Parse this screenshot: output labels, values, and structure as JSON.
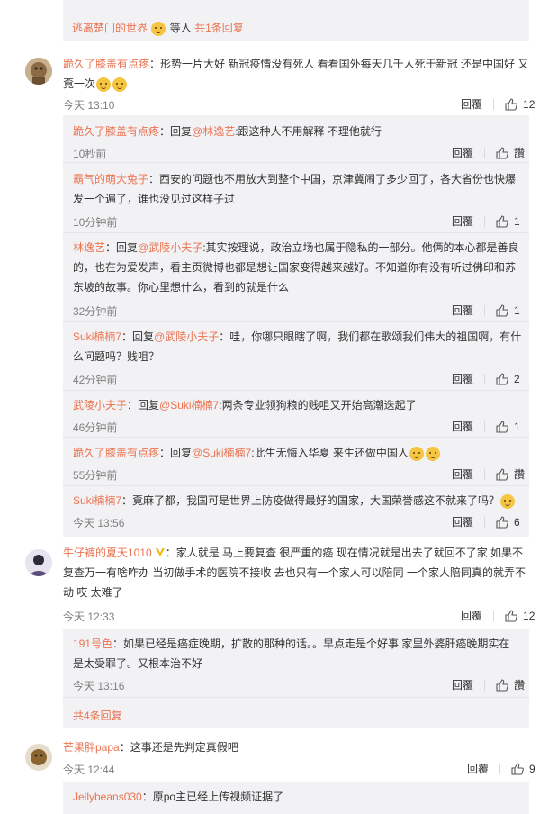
{
  "top_more": {
    "user": "逃离楚门的世界",
    "suffix": "等人",
    "link": "共1条回复"
  },
  "actions": {
    "reply": "回覆",
    "like_text": "讚"
  },
  "comments": [
    {
      "user": "跪久了膝盖有点疼",
      "text_line1": "：形势一片大好 新冠疫情没有死人 看看国外每天几千人死于新冠 还是中国好 又",
      "text_line2": "覔一次",
      "time": "今天 13:10",
      "likes": "12",
      "replies": [
        {
          "user": "跪久了膝盖有点疼",
          "pre": "：回复",
          "mention": "@林逸艺",
          "text": ":跟这种人不用解释 不理他就行",
          "time": "10秒前",
          "likes": "讚"
        },
        {
          "user": "霸气的萌大兔子",
          "text_line1": "：西安的问题也不用放大到整个中国，京津冀闹了多少回了，各大省份也快爆",
          "text_line2": "发一个遍了，谁也没见过这样子过",
          "time": "10分钟前",
          "likes": "1"
        },
        {
          "user": "林逸艺",
          "pre": "：回复",
          "mention": "@武陵小夫子",
          "text_line1": ":其实按理说，政治立场也属于隐私的一部分。他俩的本心都是善良",
          "text_line2": "的，也在为爱发声，看主页微博也都是想让国家变得越来越好。不知道你有没有听过佛印和苏",
          "text_line3": "东坡的故事。你心里想什么，看到的就是什么",
          "time": "32分钟前",
          "likes": "1"
        },
        {
          "user": "Suki楠楠7",
          "pre": "：回复",
          "mention": "@武陵小夫子",
          "text_line1": "：哇，你哪只眼瞎了啊，我们都在歌颂我们伟大的祖国啊，有什",
          "text_line2": "么问题吗？贱咀？",
          "time": "42分钟前",
          "likes": "2"
        },
        {
          "user": "武陵小夫子",
          "pre": "：回复",
          "mention": "@Suki楠楠7",
          "text": ":两条专业领狗粮的贱咀又开始高潮迭起了",
          "time": "46分钟前",
          "likes": "1"
        },
        {
          "user": "跪久了膝盖有点疼",
          "pre": "：回复",
          "mention": "@Suki楠楠7",
          "text": ":此生无悔入华夏 来生还做中国人",
          "time": "55分钟前",
          "likes": "讚"
        },
        {
          "user": "Suki楠楠7",
          "text": "：覔麻了都，我国可是世界上防疫做得最好的国家，大国荣誉感这不就来了吗？",
          "time": "今天 13:56",
          "likes": "6"
        }
      ]
    },
    {
      "user": "牛仔裤的夏天1010",
      "text_line1": "：家人就是 马上要复查 很严重的癌 现在情况就是出去了就回不了家 如果不",
      "text_line2": "复查万一有啥咋办 当初做手术的医院不接收 去也只有一个家人可以陪同 一个家人陪同真的就弄不",
      "text_line3": "动 哎 太难了",
      "time": "今天 12:33",
      "likes": "12",
      "replies": [
        {
          "user": "191号色",
          "text_line1": "：如果已经是癌症晚期，扩散的那种的话。。早点走是个好事 家里外婆肝癌晚期实在",
          "text_line2": "是太受罪了。又根本治不好",
          "time": "今天 13:16",
          "likes": "讚"
        }
      ],
      "more_link": "共4条回复"
    },
    {
      "user": "芒果胖papa",
      "text": "：这事还是先判定真假吧",
      "time": "今天 12:44",
      "likes": "9",
      "replies": [
        {
          "user": "Jellybeans030",
          "text": "：原po主已经上传视频证据了"
        }
      ]
    }
  ]
}
